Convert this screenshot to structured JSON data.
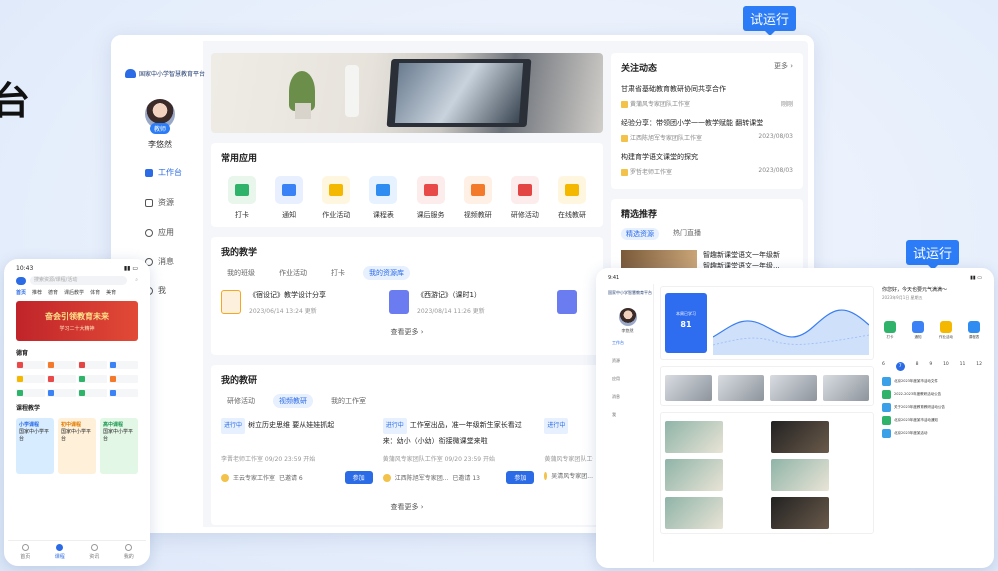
{
  "desktop": {
    "try_label": "试运行",
    "platform_name": "国家中小学智慧教育平台",
    "role_badge": "教师",
    "username": "李悠然",
    "nav": [
      "工作台",
      "资源",
      "应用",
      "消息",
      "我"
    ],
    "common_apps": {
      "title": "常用应用",
      "items": [
        {
          "label": "打卡",
          "color": "#e8f6ec",
          "icon_color": "#2fb36b",
          "icon": "check-icon"
        },
        {
          "label": "通知",
          "color": "#e8f0ff",
          "icon_color": "#3b82f6",
          "icon": "bell-icon"
        },
        {
          "label": "作业活动",
          "color": "#fff6e0",
          "icon_color": "#f5b800",
          "icon": "edit-icon"
        },
        {
          "label": "课程表",
          "color": "#e6f2ff",
          "icon_color": "#2f8cf0",
          "icon": "clock-icon"
        },
        {
          "label": "课后服务",
          "color": "#fdecec",
          "icon_color": "#e84a4a",
          "icon": "heart-icon"
        },
        {
          "label": "视频教研",
          "color": "#fff0e6",
          "icon_color": "#f27a2a",
          "icon": "video-icon"
        },
        {
          "label": "研修活动",
          "color": "#fdecec",
          "icon_color": "#e34545",
          "icon": "bookmark-icon"
        },
        {
          "label": "在线教研",
          "color": "#fff6e0",
          "icon_color": "#f5b800",
          "icon": "play-icon"
        }
      ]
    },
    "teaching": {
      "title": "我的教学",
      "tabs": [
        "我的班级",
        "作业活动",
        "打卡",
        "我的资源库"
      ],
      "active_tab": 3,
      "docs": [
        {
          "title": "《宿设记》教学设计分享",
          "date": "2023/06/14 13:24 更新",
          "color": "#f5a623"
        },
        {
          "title": "《西游记》（课时1）",
          "date": "2023/08/14 11:26 更新",
          "color": "#6b7cf0"
        }
      ],
      "more": "查看更多"
    },
    "research": {
      "title": "我的教研",
      "tabs": [
        "研修活动",
        "视频教研",
        "我的工作室"
      ],
      "active_tab": 1,
      "items": [
        {
          "tag": "进行中",
          "title": "树立历史思维 要从娃娃抓起",
          "meta": "李晋老师工作室 09/20 23:59 开始",
          "org": "王云专家工作室",
          "stat": "已邀请 6",
          "btn": "参加"
        },
        {
          "tag": "进行中",
          "title": "工作室出品，准一年级新生家长看过来：幼小（小幼）衔接微课堂来啦",
          "meta": "黄蒲风专家团队工作室 09/20 23:59 开始",
          "org": "江西陈旭军专家团...",
          "stat": "已邀请 13",
          "btn": "参加"
        },
        {
          "tag": "进行中",
          "title": "",
          "meta": "黄蒲风专家团队工作室",
          "org": "吴清风专家团...",
          "stat": "",
          "btn": ""
        }
      ],
      "more": "查看更多"
    },
    "news": {
      "title": "关注动态",
      "more": "更多",
      "items": [
        {
          "title": "甘肃省基础教育教研协同共享合作",
          "source": "黄蒲风专家团队工作室",
          "time": "刚刚"
        },
        {
          "title": "经验分享：带领团小学一一教学赋能 翻转课堂",
          "source": "江西陈旭军专家团队工作室",
          "time": "2023/08/03"
        },
        {
          "title": "构建育学语文课堂的探究",
          "source": "罗哲老师工作室",
          "time": "2023/08/03"
        }
      ]
    },
    "recommend": {
      "title": "精选推荐",
      "tabs": [
        "精选资源",
        "热门直播"
      ],
      "item_title": "智趣新课堂语文一年级新",
      "item_sub": "智趣新课堂语文一年级..."
    }
  },
  "phone": {
    "time": "10:43",
    "search_placeholder": "搜索资源/课程/活动",
    "nav": [
      "首页",
      "推荐",
      "德育",
      "课后教学",
      "体育",
      "美育"
    ],
    "banner_title": "奋会引领教育未来",
    "banner_sub": "学习二十大精神",
    "section1": "德育",
    "section2": "课程教学",
    "cards": [
      {
        "label": "小学课程",
        "sub": "国家中小学平台",
        "color": "#d8ecff"
      },
      {
        "label": "初中课程",
        "sub": "国家中小学平台",
        "color": "#fff0d9"
      },
      {
        "label": "高中课程",
        "sub": "国家中小学平台",
        "color": "#e3f7e6"
      }
    ],
    "tabbar": [
      "首页",
      "课程",
      "资讯",
      "我的"
    ]
  },
  "tablet": {
    "greeting": "你您好，今天也要元气满满～",
    "date": "2023年9月1日 星期五",
    "study_label": "本周已学习",
    "study_value": "81",
    "quick": [
      "打卡",
      "通知",
      "作业活动",
      "课程表"
    ],
    "cal_days": [
      "6",
      "7",
      "8",
      "9",
      "10",
      "11",
      "12"
    ],
    "cal_active": 1,
    "events": [
      "北京2023年度某市活动文件",
      "2022-2023年度教研活动公告",
      "关于2023年度教育教研活动公告",
      "北京2023年度某市活动通知",
      "北京2023年度某活动"
    ]
  }
}
